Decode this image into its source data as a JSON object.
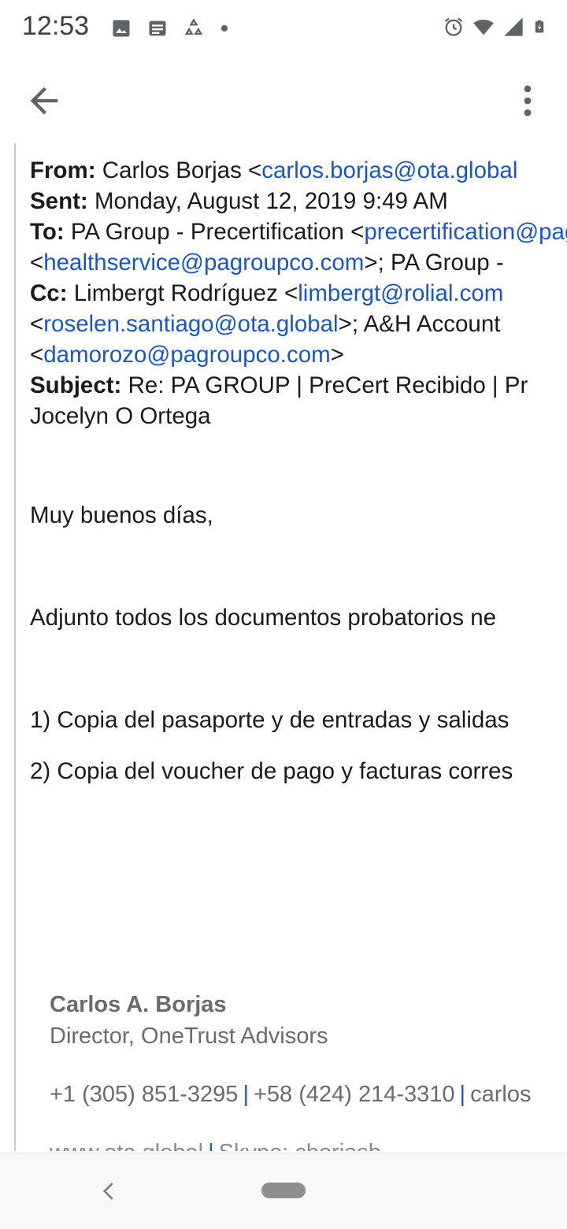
{
  "status_bar": {
    "time": "12:53",
    "left_icons": [
      "image-icon",
      "news-icon",
      "recycle-icon",
      "dot-icon"
    ],
    "right_icons": [
      "alarm-icon",
      "wifi-icon",
      "signal-icon",
      "battery-icon"
    ]
  },
  "toolbar": {
    "back_icon": "arrow-back-icon",
    "more_icon": "more-vert-icon"
  },
  "email": {
    "from_label": "From:",
    "from_name": " Carlos Borjas <",
    "from_email": "carlos.borjas@ota.global",
    "sent_label": "Sent:",
    "sent_value": " Monday, August 12, 2019 9:49 AM",
    "to_label": "To:",
    "to_name": " PA Group - Precertification <",
    "to_email": "precertification@pagroupco.com",
    "to_line2_open": "<",
    "to_email2": "healthservice@pagroupco.com",
    "to_line2_rest": ">; PA Group -",
    "cc_label": "Cc:",
    "cc_name": " Limbergt Rodríguez <",
    "cc_email": "limbergt@rolial.com",
    "cc_line2_open": "<",
    "cc_email2": "roselen.santiago@ota.global",
    "cc_line2_rest": ">; A&H Account",
    "cc_line3_open": "<",
    "cc_email3": "damorozo@pagroupco.com",
    "cc_line3_close": ">",
    "subject_label": "Subject:",
    "subject_value": " Re: PA GROUP | PreCert Recibido | Pr",
    "subject_line2": "Jocelyn O Ortega"
  },
  "body": {
    "greeting": "Muy buenos días,",
    "intro": "Adjunto todos los documentos probatorios ne",
    "item1": "1) Copia del pasaporte y de entradas y salidas",
    "item2": "2) Copia del voucher de pago y facturas corres"
  },
  "signature": {
    "name": "Carlos A. Borjas",
    "title": "Director, OneTrust Advisors",
    "phone1": "+1 (305) 851-3295",
    "separator": "|",
    "phone2": "+58 (424) 214-3310",
    "email_partial": "carlos",
    "web": "www.ota.global",
    "skype": "Skype: cborjasb"
  },
  "nav_bar": {
    "back_icon": "nav-back-icon",
    "home_icon": "home-pill-icon"
  },
  "colors": {
    "link": "#1a56c4",
    "quote_bar": "#c8c8c8",
    "signature_text": "#6b6b6b"
  }
}
